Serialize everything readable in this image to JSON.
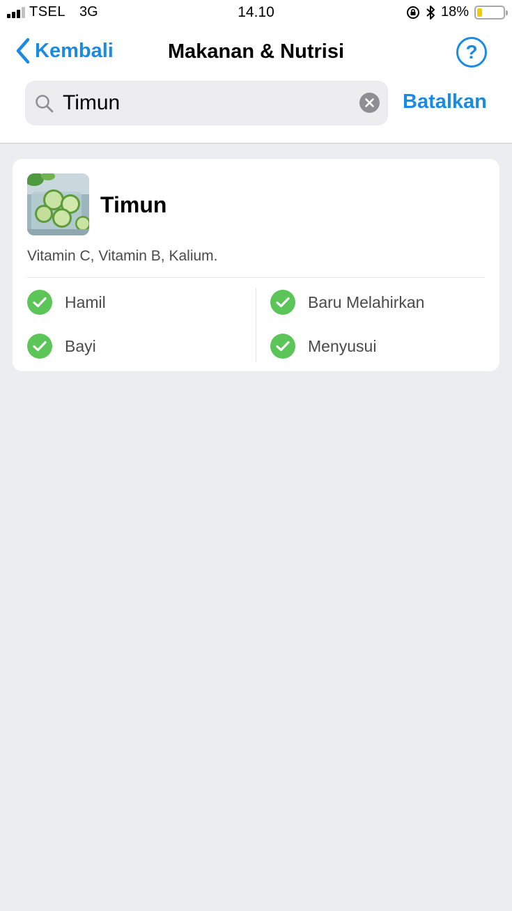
{
  "status_bar": {
    "carrier": "TSEL",
    "network": "3G",
    "time": "14.10",
    "battery_percent": "18%",
    "battery_level": 0.18,
    "battery_color": "#f5cc00"
  },
  "header": {
    "back_label": "Kembali",
    "title": "Makanan & Nutrisi",
    "help_label": "?",
    "accent_color": "#1a8ae5"
  },
  "search": {
    "value": "Timun",
    "cancel_label": "Batalkan"
  },
  "results": [
    {
      "name": "Timun",
      "nutrients": "Vitamin C, Vitamin B, Kalium.",
      "categories": [
        {
          "label": "Hamil",
          "status": "safe"
        },
        {
          "label": "Baru Melahirkan",
          "status": "safe"
        },
        {
          "label": "Bayi",
          "status": "safe"
        },
        {
          "label": "Menyusui",
          "status": "safe"
        }
      ]
    }
  ],
  "colors": {
    "safe_check": "#5cc557",
    "background": "#ecedf1"
  }
}
